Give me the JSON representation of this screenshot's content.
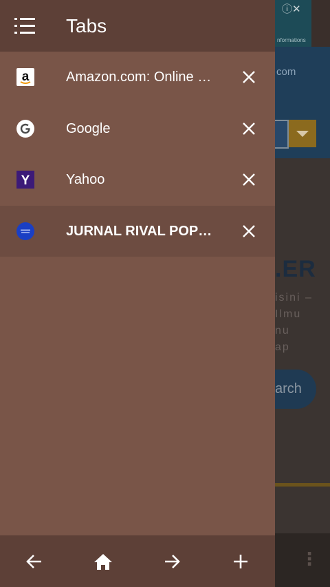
{
  "drawer": {
    "title": "Tabs",
    "tabs": [
      {
        "label": "Amazon.com: Online Shopping for Electronics",
        "favicon": "amazon-icon",
        "active": false
      },
      {
        "label": "Google",
        "favicon": "google-icon",
        "active": false
      },
      {
        "label": "Yahoo",
        "favicon": "yahoo-icon",
        "active": false
      },
      {
        "label": "JURNAL RIVAL POPULER",
        "favicon": "jurnal-rival-icon",
        "active": true
      }
    ],
    "bottom_bar": [
      "back-arrow-icon",
      "home-icon",
      "forward-arrow-icon",
      "add-tab-icon"
    ]
  },
  "background_page": {
    "ad_text": "nformations",
    "header_text": "com",
    "heading": ".ER",
    "lines": [
      "isini –",
      "Ilmu",
      "nu",
      "ap"
    ],
    "search_label": "arch"
  },
  "colors": {
    "drawer_bg": "#795548",
    "drawer_header": "#5d4037",
    "active_tab": "#6d4c41",
    "text": "#ffffff"
  }
}
